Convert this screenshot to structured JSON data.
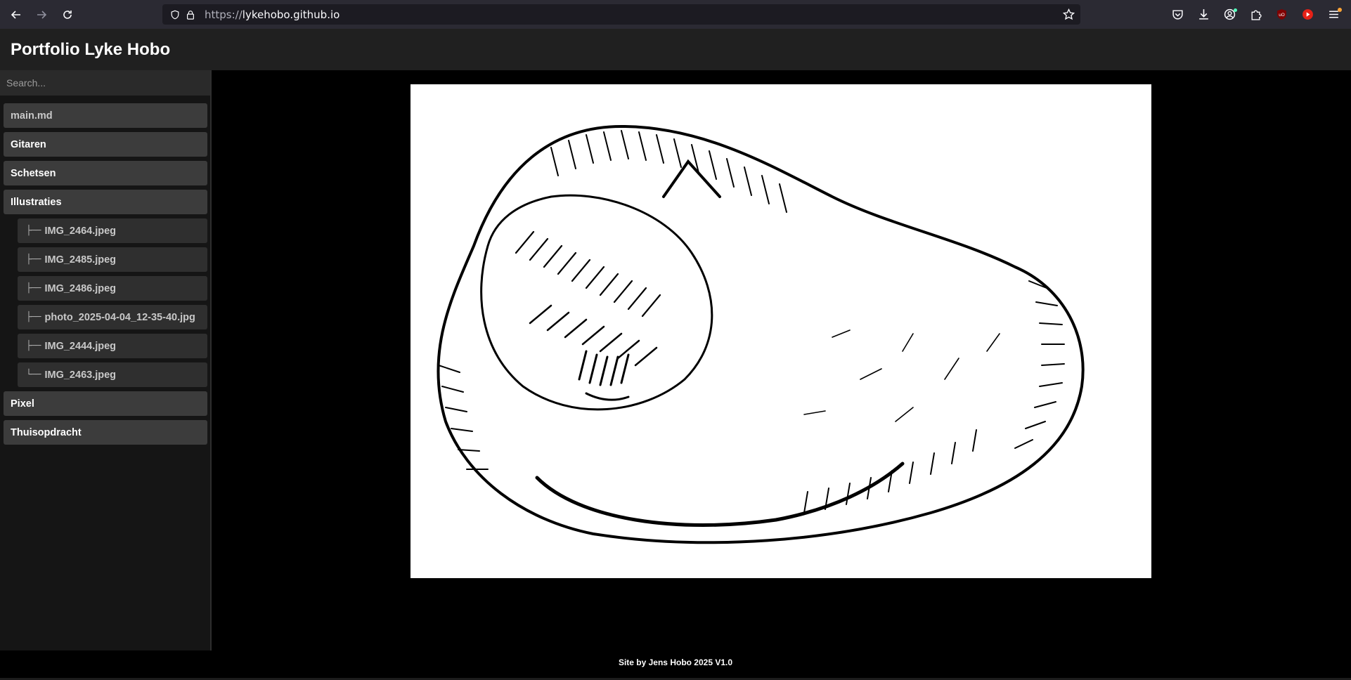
{
  "browser": {
    "url_scheme": "https://",
    "url_host": "lykehobo.github.io"
  },
  "site": {
    "title": "Portfolio Lyke Hobo"
  },
  "sidebar": {
    "search_placeholder": "Search...",
    "items": [
      {
        "label": "main.md"
      },
      {
        "label": "Gitaren"
      },
      {
        "label": "Schetsen"
      },
      {
        "label": "Illustraties"
      },
      {
        "branch": "├──",
        "label": "IMG_2464.jpeg"
      },
      {
        "branch": "├──",
        "label": "IMG_2485.jpeg"
      },
      {
        "branch": "├──",
        "label": "IMG_2486.jpeg"
      },
      {
        "branch": "├──",
        "label": "photo_2025-04-04_12-35-40.jpg"
      },
      {
        "branch": "├──",
        "label": "IMG_2444.jpeg"
      },
      {
        "branch": "└──",
        "label": "IMG_2463.jpeg"
      },
      {
        "label": "Pixel"
      },
      {
        "label": "Thuisopdracht"
      }
    ]
  },
  "footer": {
    "text": "Site by Jens Hobo 2025 V1.0"
  },
  "colors": {
    "chrome": "#2b2a33",
    "urlbar": "#1c1b22",
    "header": "#202020",
    "nav_item": "#3c3c3c",
    "page_bg": "#000000"
  }
}
